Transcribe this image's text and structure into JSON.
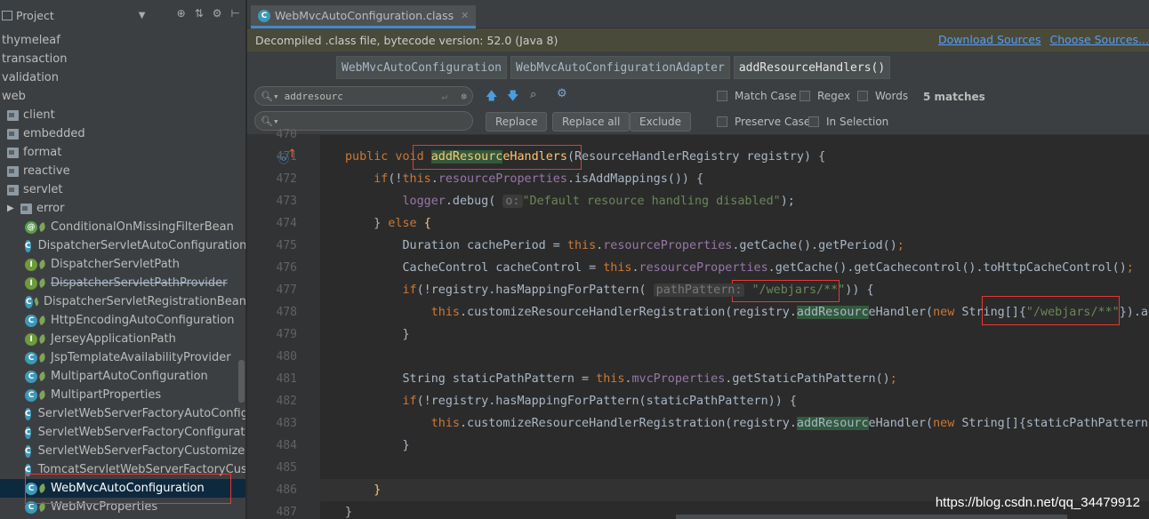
{
  "project_panel": {
    "title": "Project",
    "rows": [
      {
        "label": "thymeleaf",
        "kind": "text",
        "indent": 0
      },
      {
        "label": "transaction",
        "kind": "text",
        "indent": 0
      },
      {
        "label": "validation",
        "kind": "text",
        "indent": 0
      },
      {
        "label": "web",
        "kind": "text",
        "indent": 0
      },
      {
        "label": "client",
        "kind": "package",
        "indent": 1
      },
      {
        "label": "embedded",
        "kind": "package",
        "indent": 1
      },
      {
        "label": "format",
        "kind": "package",
        "indent": 1
      },
      {
        "label": "reactive",
        "kind": "package",
        "indent": 1
      },
      {
        "label": "servlet",
        "kind": "package",
        "indent": 1
      },
      {
        "label": "error",
        "kind": "folder",
        "indent": 2
      },
      {
        "label": "ConditionalOnMissingFilterBean",
        "kind": "annotation",
        "indent": 3
      },
      {
        "label": "DispatcherServletAutoConfiguration",
        "kind": "class",
        "indent": 3
      },
      {
        "label": "DispatcherServletPath",
        "kind": "interface",
        "indent": 3
      },
      {
        "label": "DispatcherServletPathProvider",
        "kind": "interface",
        "indent": 3,
        "strike": true
      },
      {
        "label": "DispatcherServletRegistrationBean",
        "kind": "class",
        "indent": 3
      },
      {
        "label": "HttpEncodingAutoConfiguration",
        "kind": "class",
        "indent": 3
      },
      {
        "label": "JerseyApplicationPath",
        "kind": "interface",
        "indent": 3
      },
      {
        "label": "JspTemplateAvailabilityProvider",
        "kind": "class",
        "indent": 3
      },
      {
        "label": "MultipartAutoConfiguration",
        "kind": "class",
        "indent": 3
      },
      {
        "label": "MultipartProperties",
        "kind": "class",
        "indent": 3
      },
      {
        "label": "ServletWebServerFactoryAutoConfigu",
        "kind": "class",
        "indent": 3
      },
      {
        "label": "ServletWebServerFactoryConfiguratio",
        "kind": "class",
        "indent": 3
      },
      {
        "label": "ServletWebServerFactoryCustomizer",
        "kind": "class",
        "indent": 3
      },
      {
        "label": "TomcatServletWebServerFactoryCust",
        "kind": "class",
        "indent": 3
      },
      {
        "label": "WebMvcAutoConfiguration",
        "kind": "class",
        "indent": 3,
        "selected": true
      },
      {
        "label": "WebMvcProperties",
        "kind": "class",
        "indent": 3
      }
    ]
  },
  "editor": {
    "tab_label": "WebMvcAutoConfiguration.class",
    "banner_text": "Decompiled .class file, bytecode version: 52.0 (Java 8)",
    "download_sources": "Download Sources",
    "choose_sources": "Choose Sources...",
    "breadcrumbs": [
      "WebMvcAutoConfiguration",
      "WebMvcAutoConfigurationAdapter",
      "addResourceHandlers()"
    ]
  },
  "find_bar": {
    "search_value": "addresourc",
    "replace_value": "",
    "replace_label": "Replace",
    "replace_all_label": "Replace all",
    "exclude_label": "Exclude",
    "match_case": "Match Case",
    "regex": "Regex",
    "words": "Words",
    "matches": "5 matches",
    "preserve_case": "Preserve Case",
    "in_selection": "In Selection"
  },
  "code_lines": [
    {
      "n": "470",
      "html": ""
    },
    {
      "n": "471",
      "html": "<span class='kw'>public void </span><span class='fn'><span class='hl'>addResourc</span>eHandlers</span>(ResourceHandlerRegistry registry) {"
    },
    {
      "n": "472",
      "html": "    <span class='kw'>if</span>(!<span class='kw'>this</span>.<span class='fld'>resourceProperties</span>.isAddMappings()) {"
    },
    {
      "n": "473",
      "html": "        <span class='fld'>logger</span>.debug( <span class='hint'>o:</span><span class='str'>\"Default resource handling disabled\"</span>);"
    },
    {
      "n": "474",
      "html": "    } <span class='kw'>else</span> <span class='fn'>{</span>"
    },
    {
      "n": "475",
      "html": "        Duration cachePeriod = <span class='kw'>this</span>.<span class='fld'>resourceProperties</span>.getCache().getPeriod()<span class='kw'>;</span>"
    },
    {
      "n": "476",
      "html": "        CacheControl cacheControl = <span class='kw'>this</span>.<span class='fld'>resourceProperties</span>.getCache().getCachecontrol().toHttpCacheControl()<span class='kw'>;</span>"
    },
    {
      "n": "477",
      "html": "        <span class='kw'>if</span>(!registry.hasMappingForPattern( <span class='hint'>pathPattern:</span> <span class='str'>\"/webjars/**\"</span>)) {"
    },
    {
      "n": "478",
      "html": "            <span class='kw'>this</span>.customizeResourceHandlerRegistration(registry.<span class='hl'>addResourc</span>eHandler(<span class='kw'>new </span>String[]{<span class='str'>\"/webjars/**\"</span>}).addResourceLocations("
    },
    {
      "n": "479",
      "html": "        }"
    },
    {
      "n": "480",
      "html": ""
    },
    {
      "n": "481",
      "html": "        String staticPathPattern = <span class='kw'>this</span>.<span class='fld'>mvcProperties</span>.getStaticPathPattern()<span class='kw'>;</span>"
    },
    {
      "n": "482",
      "html": "        <span class='kw'>if</span>(!registry.hasMappingForPattern(staticPathPattern)) {"
    },
    {
      "n": "483",
      "html": "            <span class='kw'>this</span>.customizeResourceHandlerRegistration(registry.<span class='hl'>addResourc</span>eHandler(<span class='kw'>new </span>String[]{staticPathPattern}).addResour"
    },
    {
      "n": "484",
      "html": "        }"
    },
    {
      "n": "485",
      "html": ""
    },
    {
      "n": "486",
      "html": "    <span class='fn'>}</span>"
    },
    {
      "n": "487",
      "html": "}"
    }
  ],
  "watermark": "https://blog.csdn.net/qq_34479912",
  "colors": {
    "keyword": "#cc7832",
    "string": "#6a8759",
    "function": "#ffc66d",
    "field": "#9876aa",
    "highlight": "#32593d",
    "selection": "#0d293e"
  }
}
